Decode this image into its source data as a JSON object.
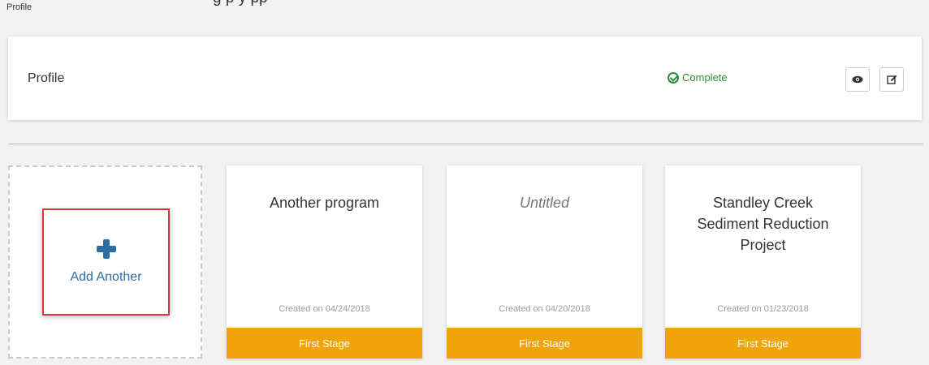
{
  "top_fragment": "g                 p      y     pp",
  "breadcrumb": "Profile",
  "profile": {
    "title": "Profile",
    "status": "Complete",
    "status_color": "#2e8b3d"
  },
  "add_tile": {
    "label": "Add Another"
  },
  "programs": [
    {
      "title": "Another program",
      "created": "Created on 04/24/2018",
      "stage": "First Stage"
    },
    {
      "title": "Untitled",
      "created": "Created on 04/20/2018",
      "stage": "First Stage"
    },
    {
      "title": "Standley Creek Sediment Reduction Project",
      "created": "Created on 01/23/2018",
      "stage": "First Stage"
    }
  ],
  "colors": {
    "accent": "#2e6da4",
    "stage": "#f0a30a",
    "highlight": "#d9363e"
  }
}
